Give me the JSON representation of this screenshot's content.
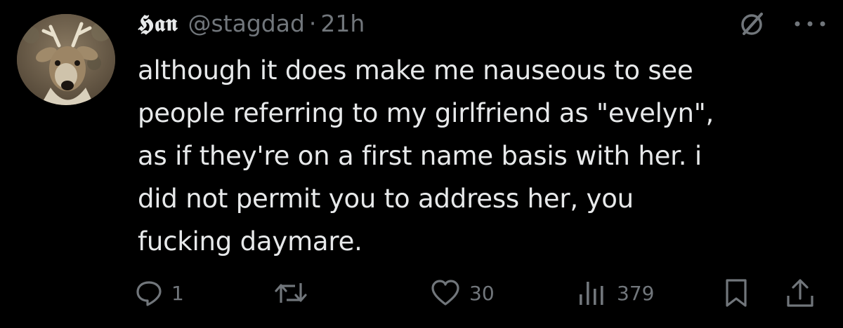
{
  "author": {
    "display_name": "𝕳𝖆𝖓",
    "handle": "@stagdad",
    "separator": "·",
    "time": "21h",
    "avatar_icon": "deer-avatar"
  },
  "tweet": {
    "text": "although it does make me nauseous to see\npeople referring to my girlfriend as \"evelyn\",\nas if they're on a first name basis with her. i\ndid not permit you to address her, you\nfucking daymare."
  },
  "header_icons": [
    "grok-icon",
    "more-icon"
  ],
  "actions": {
    "reply_count": "1",
    "retweet_count": "",
    "like_count": "30",
    "views_count": "379"
  },
  "colors": {
    "background": "#000000",
    "text_primary": "#e7e9ea",
    "text_secondary": "#71767b"
  }
}
